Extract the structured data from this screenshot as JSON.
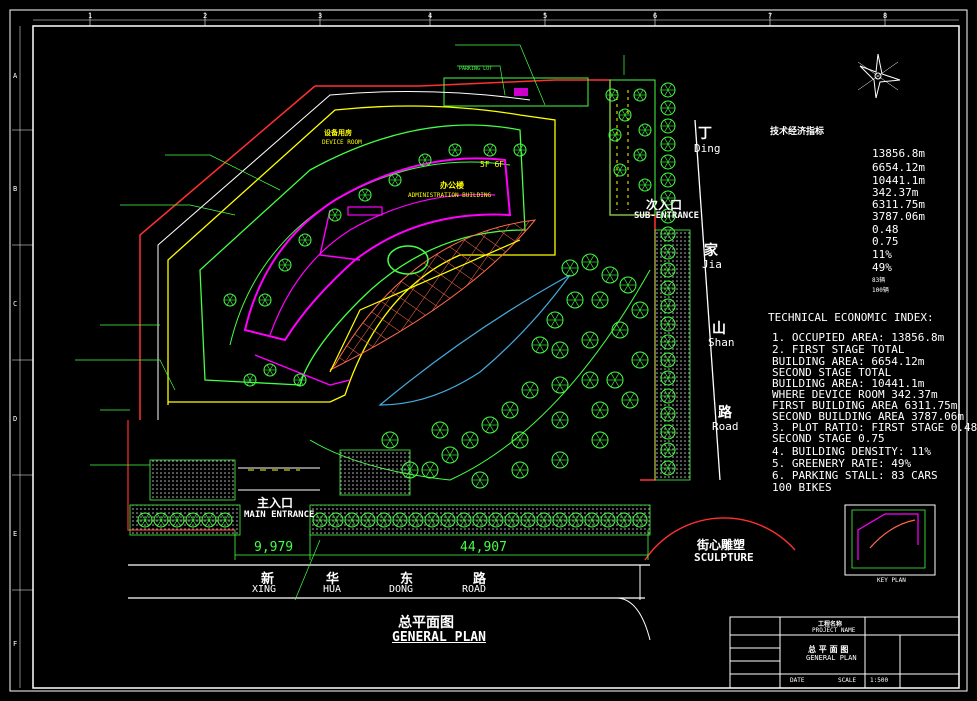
{
  "drawing": {
    "title_cn": "总平面图",
    "title_en": "GENERAL PLAN",
    "sheet_ruler": [
      "1",
      "2",
      "3",
      "4",
      "5",
      "6",
      "7",
      "8"
    ],
    "side_ruler": [
      "A",
      "B",
      "C",
      "D",
      "E",
      "F"
    ]
  },
  "roads": {
    "xinhua_dong": [
      {
        "cn": "新",
        "en": "XING"
      },
      {
        "cn": "华",
        "en": "HUA"
      },
      {
        "cn": "东",
        "en": "DONG"
      },
      {
        "cn": "路",
        "en": "ROAD"
      }
    ],
    "dingjiashan": [
      {
        "cn": "丁",
        "en": "Ding"
      },
      {
        "cn": "家",
        "en": "Jia"
      },
      {
        "cn": "山",
        "en": "Shan"
      },
      {
        "cn": "路",
        "en": "Road"
      }
    ]
  },
  "labels": {
    "main_entrance_cn": "主入口",
    "main_entrance_en": "MAIN ENTRANCE",
    "sub_entrance_cn": "次入口",
    "sub_entrance_en": "SUB-ENTRANCE",
    "sculpture_cn": "街心雕塑",
    "sculpture_en": "SCULPTURE",
    "admin_cn": "办公楼",
    "admin_en": "ADMINISTRATION BUILDING",
    "device_cn": "设备用房",
    "device_en": "DEVICE ROOM",
    "floors": "5F 6F",
    "parking_lot": "PARKING LOT",
    "key_plan": "KEY PLAN"
  },
  "dimensions": {
    "left": "9,979",
    "right": "44,907"
  },
  "index": {
    "header_cn": "技术经济指标",
    "cn_values": [
      "13856.8m",
      "6654.12m",
      "10441.1m",
      "342.37m",
      "6311.75m",
      "3787.06m",
      "0.48",
      "0.75",
      "11%",
      "49%",
      "83辆",
      "100辆"
    ],
    "header_en": "TECHNICAL ECONOMIC INDEX:",
    "en_lines": [
      "1.   OCCUPIED AREA: 13856.8m",
      "2.     FIRST STAGE TOTAL",
      "       BUILDING AREA:  6654.12m",
      "       SECOND STAGE TOTAL",
      "       BUILDING AREA:  10441.1m",
      "       WHERE DEVICE ROOM  342.37m",
      "       FIRST BUILDING AREA  6311.75m",
      "       SECOND BUILDING AREA  3787.06m",
      "3.   PLOT RATIO:   FIRST STAGE  0.48",
      "                    SECOND STAGE  0.75",
      "4.   BUILDING DENSITY: 11%",
      "5.   GREENERY RATE: 49%",
      "6.   PARKING STALL:  83 CARS",
      "                      100  BIKES"
    ]
  },
  "title_block": {
    "project_cn": "工程名称",
    "project_en": "PROJECT NAME",
    "sheet_cn": "总 平 面 图",
    "sheet_en": "GENERAL PLAN",
    "scale_label": "SCALE",
    "scale_value": "1:500",
    "date_label": "DATE"
  },
  "colors": {
    "background": "#000000",
    "frame": "#ffffff",
    "buildings": "#ff00ff",
    "landscape": "#00ff00",
    "roads": "#ffff00",
    "boundary": "#ff3030"
  }
}
